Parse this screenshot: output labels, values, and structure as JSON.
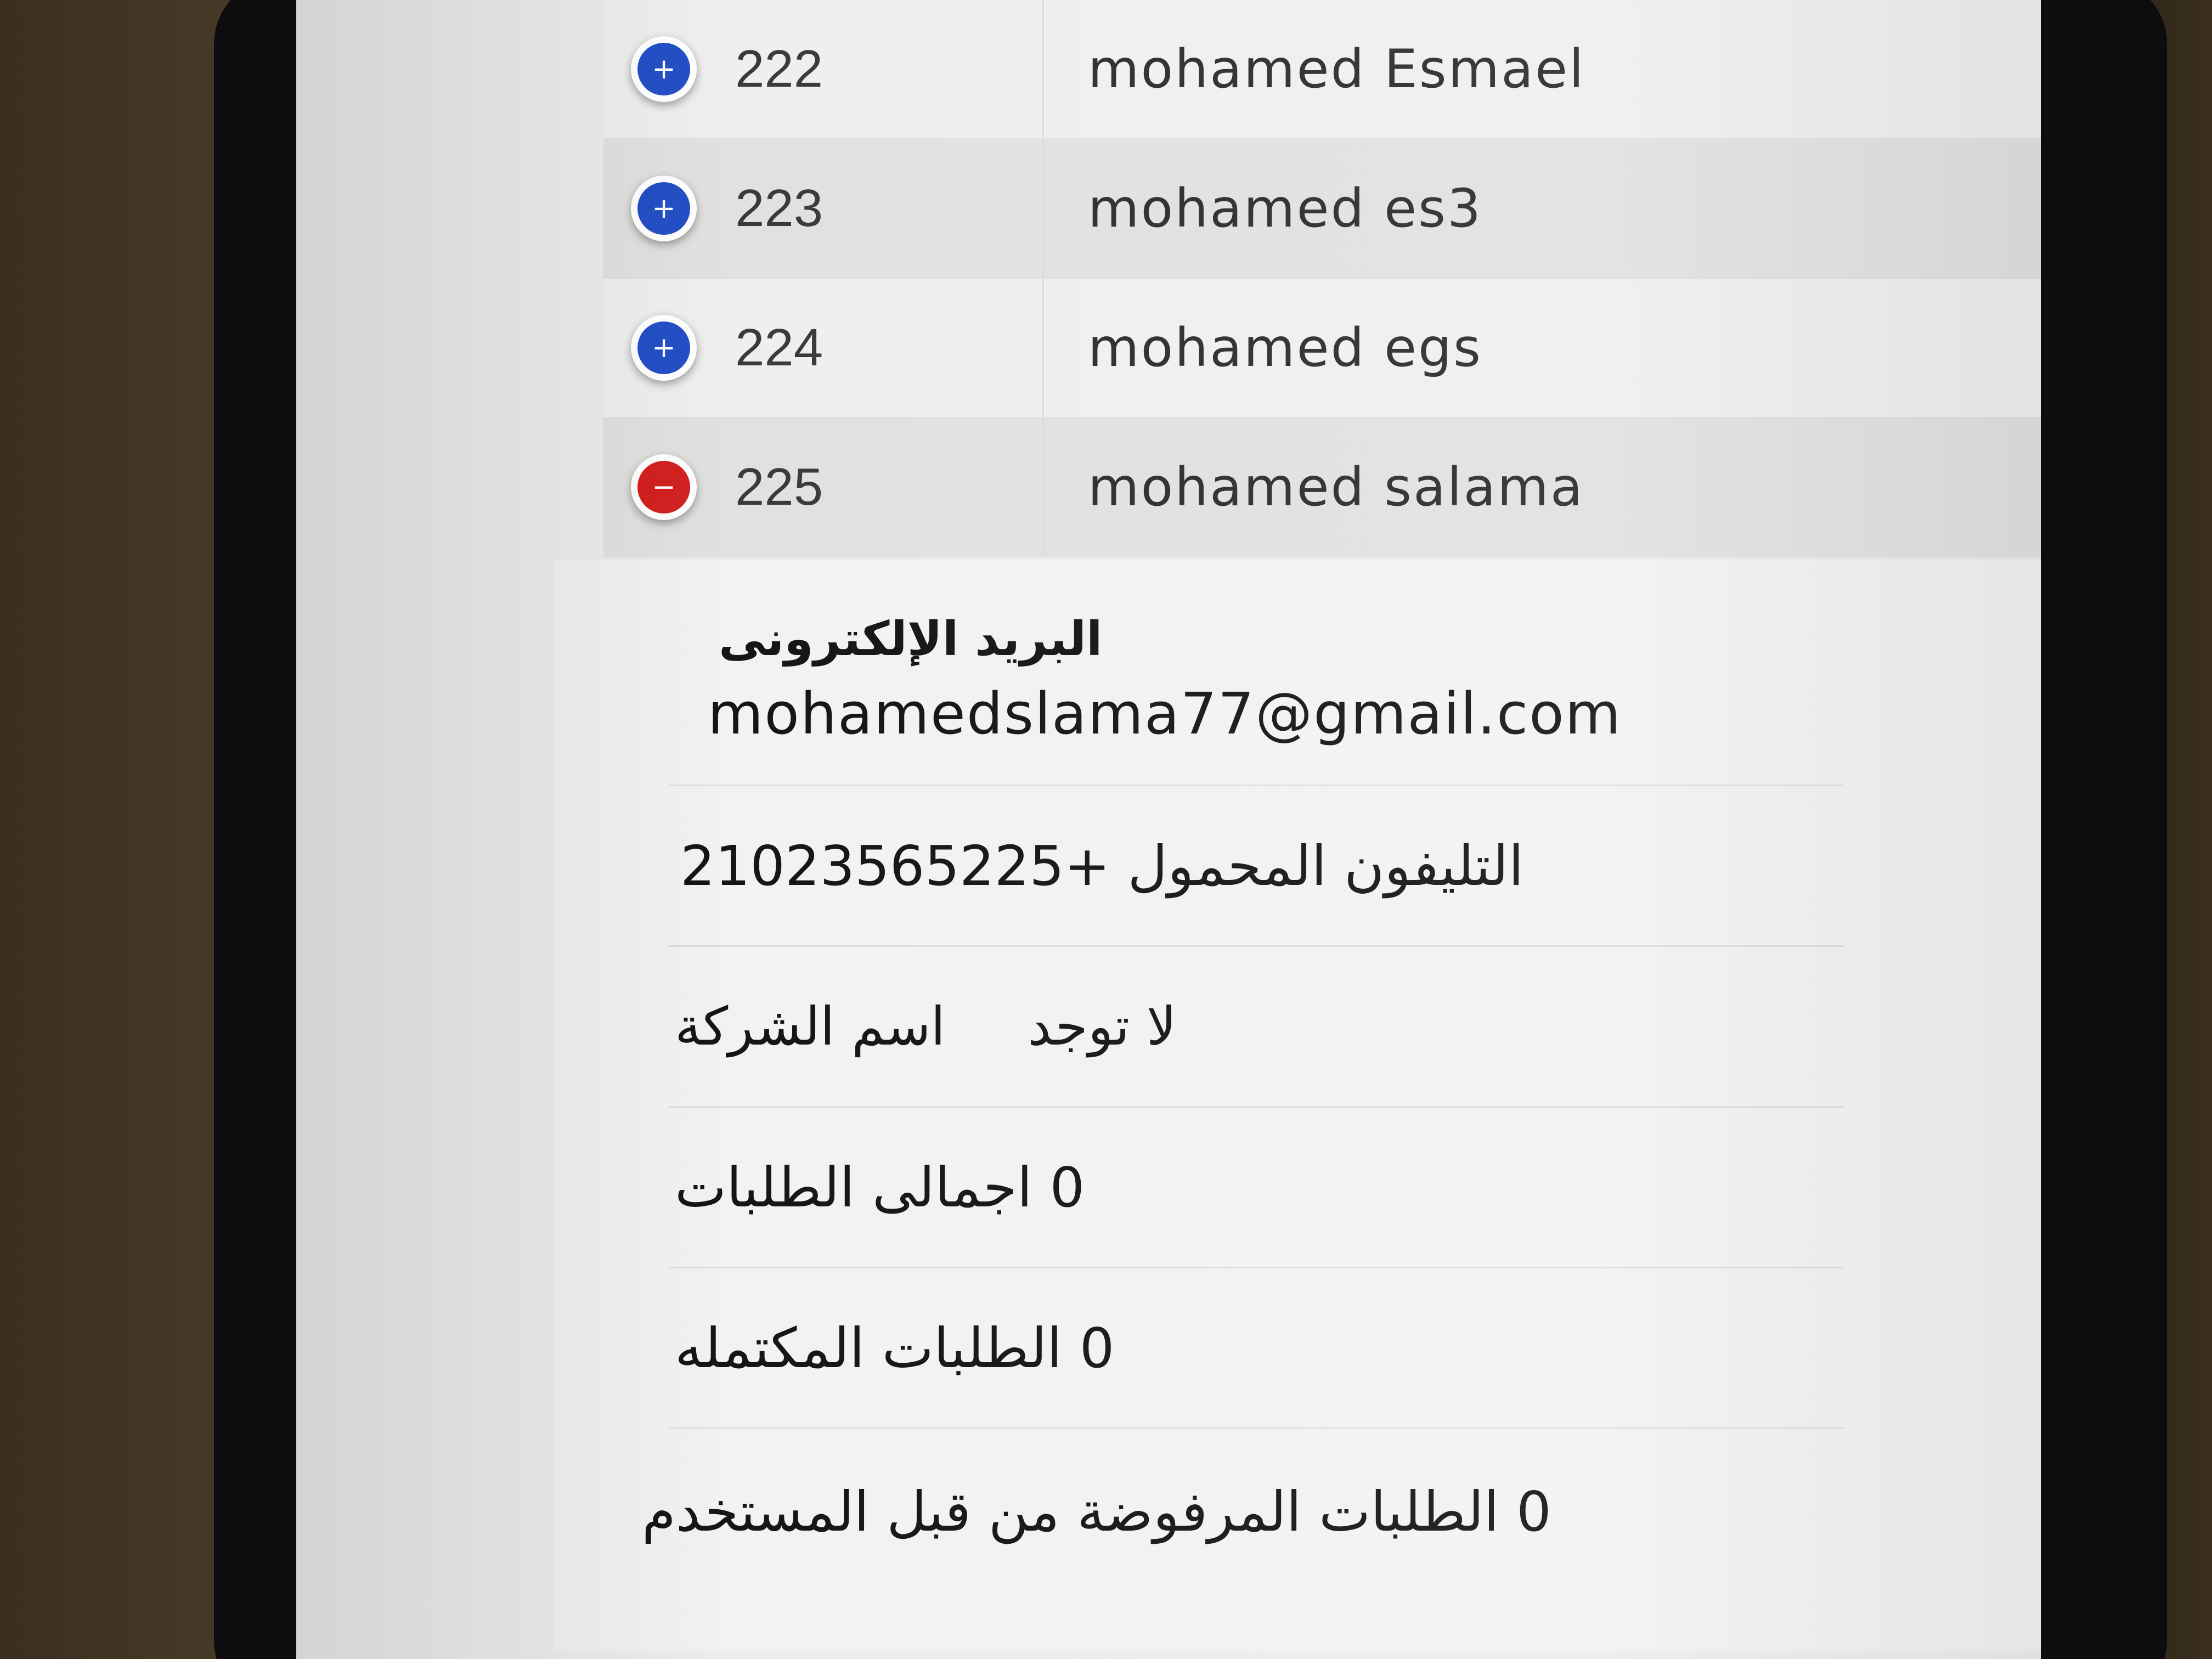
{
  "users": [
    {
      "id": "222",
      "name": "mohamed Esmael",
      "toggle": "plus"
    },
    {
      "id": "223",
      "name": "mohamed es3",
      "toggle": "plus"
    },
    {
      "id": "224",
      "name": "mohamed egs",
      "toggle": "plus"
    },
    {
      "id": "225",
      "name": "mohamed salama",
      "toggle": "minus"
    }
  ],
  "toggle_symbols": {
    "plus": "+",
    "minus": "−"
  },
  "toggle_colors": {
    "plus": "#2450c6",
    "minus": "#d32121"
  },
  "details": {
    "email_label": "البريد الإلكترونى",
    "email_value": "mohamedslama77@gmail.com",
    "phone_line": "التليفون المحمول +21023565225",
    "company_label": "اسم الشركة",
    "company_value": "لا توجد",
    "total_orders_line": "0 اجمالى الطلبات",
    "completed_orders_line": "0 الطلبات المكتمله",
    "rejected_orders_line": "0 الطلبات المرفوضة من قبل المستخدم"
  }
}
